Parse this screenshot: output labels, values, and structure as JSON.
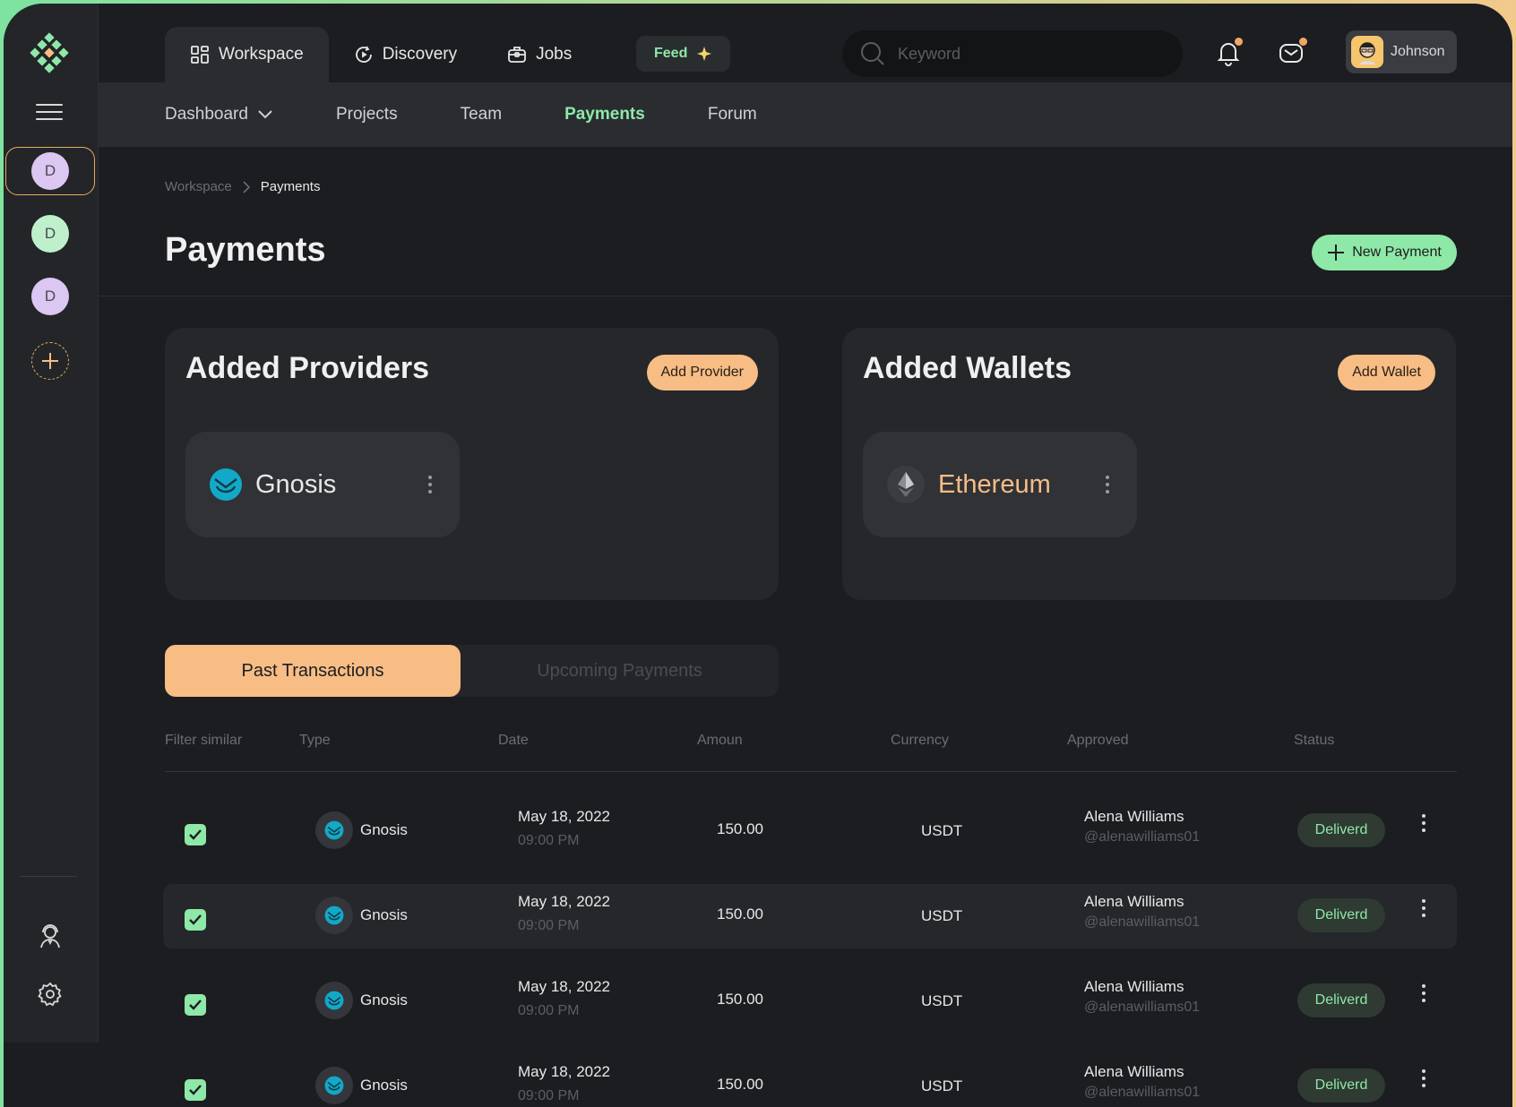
{
  "colors": {
    "accent_green": "#8ee8a8",
    "accent_orange": "#f7bd85",
    "background": "#1c1d20",
    "panel": "#25272a"
  },
  "topnav": {
    "items": [
      {
        "label": "Workspace",
        "icon": "grid-icon"
      },
      {
        "label": "Discovery",
        "icon": "discovery-icon"
      },
      {
        "label": "Jobs",
        "icon": "briefcase-icon"
      }
    ],
    "feed_label": "Feed",
    "search_placeholder": "Keyword",
    "user_name": "Johnson"
  },
  "rail": {
    "workspaces": [
      {
        "initial": "D",
        "color": "#dcc6f2"
      },
      {
        "initial": "D",
        "color": "#bff0cc"
      },
      {
        "initial": "D",
        "color": "#dcc6f2"
      }
    ]
  },
  "subnav": {
    "items": [
      {
        "label": "Dashboard"
      },
      {
        "label": "Projects"
      },
      {
        "label": "Team"
      },
      {
        "label": "Payments"
      },
      {
        "label": "Forum"
      }
    ],
    "active": "Payments"
  },
  "breadcrumb": {
    "parent": "Workspace",
    "current": "Payments"
  },
  "page": {
    "title": "Payments",
    "new_button": "New Payment"
  },
  "providers": {
    "title": "Added Providers",
    "button": "Add Provider",
    "items": [
      {
        "name": "Gnosis",
        "icon": "gnosis-icon"
      }
    ]
  },
  "wallets": {
    "title": "Added Wallets",
    "button": "Add Wallet",
    "items": [
      {
        "name": "Ethereum",
        "icon": "ethereum-icon"
      }
    ]
  },
  "tabs": {
    "active": "Past Transactions",
    "inactive": "Upcoming Payments"
  },
  "table": {
    "headers": [
      "Filter similar",
      "Type",
      "Date",
      "Amoun",
      "Currency",
      "Approved",
      "Status"
    ],
    "rows": [
      {
        "type": "Gnosis",
        "date": "May 18, 2022",
        "time": "09:00 PM",
        "amount": "150.00",
        "currency": "USDT",
        "approver": "Alena Williams",
        "handle": "@alenawilliams01",
        "status": "Deliverd"
      },
      {
        "type": "Gnosis",
        "date": "May 18, 2022",
        "time": "09:00 PM",
        "amount": "150.00",
        "currency": "USDT",
        "approver": "Alena Williams",
        "handle": "@alenawilliams01",
        "status": "Deliverd"
      },
      {
        "type": "Gnosis",
        "date": "May 18, 2022",
        "time": "09:00 PM",
        "amount": "150.00",
        "currency": "USDT",
        "approver": "Alena Williams",
        "handle": "@alenawilliams01",
        "status": "Deliverd"
      },
      {
        "type": "Gnosis",
        "date": "May 18, 2022",
        "time": "09:00 PM",
        "amount": "150.00",
        "currency": "USDT",
        "approver": "Alena Williams",
        "handle": "@alenawilliams01",
        "status": "Deliverd"
      }
    ]
  }
}
